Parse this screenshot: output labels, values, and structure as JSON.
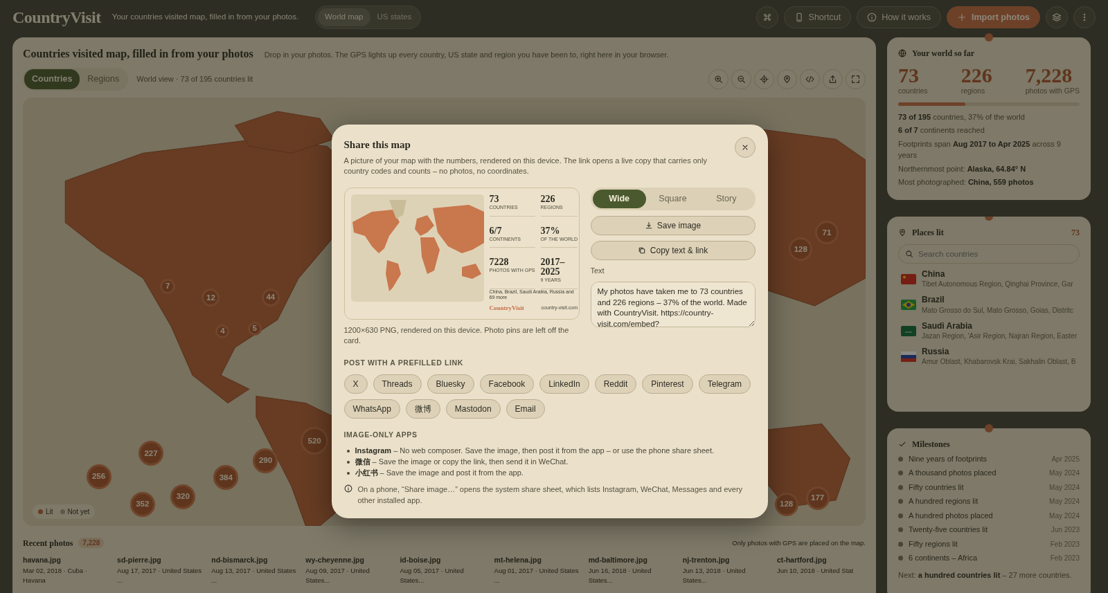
{
  "header": {
    "logo": "CountryVisit",
    "tagline": "Your countries visited map, filled in from your photos.",
    "views": [
      {
        "label": "World map",
        "selected": true
      },
      {
        "label": "US states",
        "selected": false
      }
    ],
    "actions": [
      "Shortcut",
      "How it works",
      "Import photos"
    ]
  },
  "map": {
    "title": "Countries visited map, filled in from your photos",
    "description": "Drop in your photos. The GPS lights up every country, US state and region you have been to, right here in your browser.",
    "tabs": [
      {
        "label": "Countries",
        "selected": true
      },
      {
        "label": "Regions",
        "selected": false
      }
    ],
    "status": "World view · 73 of 195 countries lit",
    "clusters": [
      "7",
      "12",
      "44",
      "4",
      "5",
      "227",
      "256",
      "320",
      "352",
      "384",
      "290",
      "520",
      "71",
      "128",
      "177",
      "128"
    ],
    "legend": [
      {
        "label": "Lit",
        "kind": "lit"
      },
      {
        "label": "Not yet",
        "kind": "unlit"
      }
    ]
  },
  "recent": {
    "title": "Recent photos",
    "count": "7,228",
    "note": "Only photos with GPS are placed on the map.",
    "items": [
      {
        "name": "havana.jpg",
        "meta": "Mar 02, 2018 · Cuba · Havana"
      },
      {
        "name": "sd-pierre.jpg",
        "meta": "Aug 17, 2017 · United States ..."
      },
      {
        "name": "nd-bismarck.jpg",
        "meta": "Aug 13, 2017 · United States ..."
      },
      {
        "name": "wy-cheyenne.jpg",
        "meta": "Aug 09, 2017 · United States..."
      },
      {
        "name": "id-boise.jpg",
        "meta": "Aug 05, 2017 · United States..."
      },
      {
        "name": "mt-helena.jpg",
        "meta": "Aug 01, 2017 · United States ..."
      },
      {
        "name": "md-baltimore.jpg",
        "meta": "Jun 16, 2018 · United States..."
      },
      {
        "name": "nj-trenton.jpg",
        "meta": "Jun 13, 2018 · United States..."
      },
      {
        "name": "ct-hartford.jpg",
        "meta": "Jun 10, 2018 · United Stat"
      }
    ]
  },
  "summary": {
    "title": "Your world so far",
    "stats": [
      {
        "value": "73",
        "label": "countries"
      },
      {
        "value": "226",
        "label": "regions"
      },
      {
        "value": "7,228",
        "label": "photos with GPS"
      }
    ],
    "level": 0.37,
    "lines": [
      "**73 of 195** countries, 37% of the world",
      "**6 of 7** continents reached",
      "Footprints span **Aug 2017 to Apr 2025** across 9 years",
      "Northernmost point: **Alaska, 64.84° N**",
      "Most photographed: **China, 559 photos**"
    ]
  },
  "places": {
    "title": "Places lit",
    "count": "73",
    "search": {
      "placeholder": "Search countries"
    },
    "items": [
      {
        "name": "China",
        "regions": "Tibet Autonomous Region, Qinghai Province, Gar"
      },
      {
        "name": "Brazil",
        "regions": "Mato Grosso do Sul, Mato Grosso, Goias, Distritc"
      },
      {
        "name": "Saudi Arabia",
        "regions": "Jazan Region, 'Asir Region, Najran Region, Easter"
      },
      {
        "name": "Russia",
        "regions": "Amur Oblast, Khabarovsk Krai, Sakhalin Oblast, B"
      }
    ]
  },
  "milestones": {
    "title": "Milestones",
    "items": [
      {
        "label": "Nine years of footprints",
        "date": "Apr 2025"
      },
      {
        "label": "A thousand photos placed",
        "date": "May 2024"
      },
      {
        "label": "Fifty countries lit",
        "date": "May 2024"
      },
      {
        "label": "A hundred regions lit",
        "date": "May 2024"
      },
      {
        "label": "A hundred photos placed",
        "date": "May 2024"
      },
      {
        "label": "Twenty-five countries lit",
        "date": "Jun 2023"
      },
      {
        "label": "Fifty regions lit",
        "date": "Feb 2023"
      },
      {
        "label": "6 continents – Africa",
        "date": "Feb 2023"
      }
    ],
    "next": "Next: **a hundred countries lit** – 27 more countries."
  },
  "modal": {
    "title": "Share this map",
    "description": "A picture of your map with the numbers, rendered on this device. The link opens a live copy that carries only country codes and counts – no photos, no coordinates.",
    "preview": {
      "stats": [
        {
          "value": "73",
          "label": "COUNTRIES"
        },
        {
          "value": "226",
          "label": "REGIONS"
        },
        {
          "value": "6/7",
          "label": "CONTINENTS"
        },
        {
          "value": "37%",
          "label": "OF THE WORLD"
        },
        {
          "value": "7228",
          "label": "PHOTOS WITH GPS"
        },
        {
          "value": "2017–2025",
          "label": "9 YEARS"
        }
      ],
      "countries": "China, Brazil, Saudi Arabia, Russia and 69 more",
      "brand": "CountryVisit",
      "url": "country-visit.com"
    },
    "caption": "1200×630 PNG, rendered on this device. Photo pins are left off the card.",
    "formats": [
      {
        "label": "Wide",
        "selected": true
      },
      {
        "label": "Square",
        "selected": false
      },
      {
        "label": "Story",
        "selected": false
      }
    ],
    "buttons": [
      "Save image",
      "Copy text & link"
    ],
    "text_label": "Text",
    "text_value": "My photos have taken me to 73 countries and 226 regions – 37% of the world. Made with CountryVisit. https://country-visit.com/embed?",
    "post_heading": "POST WITH A PREFILLED LINK",
    "post_targets": [
      "X",
      "Threads",
      "Bluesky",
      "Facebook",
      "LinkedIn",
      "Reddit",
      "Pinterest",
      "Telegram",
      "WhatsApp",
      "微博",
      "Mastodon",
      "Email"
    ],
    "image_heading": "IMAGE-ONLY APPS",
    "image_apps": [
      "**Instagram** – No web composer. Save the image, then post it from the app – or use the phone share sheet.",
      "**微信** – Save the image or copy the link, then send it in WeChat.",
      "**小红书** – Save the image and post it from the app."
    ],
    "note": "On a phone, “Share image…” opens the system share sheet, which lists Instagram, WeChat, Messages and every other installed app."
  }
}
